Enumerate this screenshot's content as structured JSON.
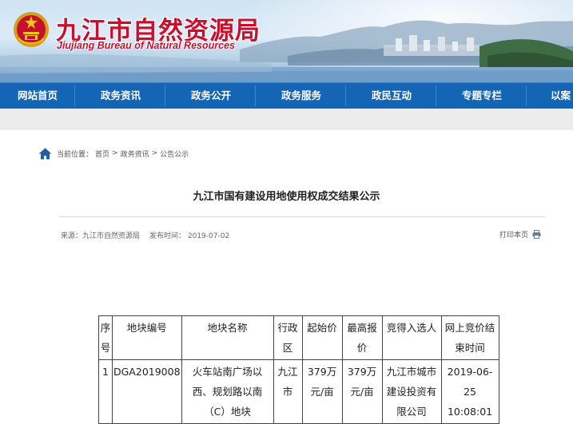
{
  "header": {
    "title_cn": "九江市自然资源局",
    "title_en": "Jiujiang Bureau of Natural Resources"
  },
  "nav": {
    "items": [
      {
        "label": "网站首页"
      },
      {
        "label": "政务资讯"
      },
      {
        "label": "政务公开"
      },
      {
        "label": "政务服务"
      },
      {
        "label": "政民互动"
      },
      {
        "label": "专题专栏"
      },
      {
        "label": "以案"
      }
    ]
  },
  "breadcrumb": {
    "prefix": "当前位置：",
    "items": [
      "首页",
      "政务资讯",
      "公告公示"
    ],
    "separator": ">"
  },
  "article": {
    "title": "九江市国有建设用地使用权成交结果公示",
    "source": "来源：九江市自然资源局",
    "date": "发布时间： 2019-07-02",
    "print_label": "打印本页"
  },
  "table": {
    "headers": [
      {
        "text": "序号"
      },
      {
        "text": "地块编号"
      },
      {
        "text": "地块名称"
      },
      {
        "text": "行政区"
      },
      {
        "text": "起始价"
      },
      {
        "text": "最高报价"
      },
      {
        "text": "竞得入选人"
      },
      {
        "text": "网上竞价结束时间"
      }
    ],
    "rows": [
      {
        "cells": [
          {
            "text": "1"
          },
          {
            "text": "DGA2019008"
          },
          {
            "text": "火车站南广场以西、规划路以南（C）地块"
          },
          {
            "text": "九江市"
          },
          {
            "text": "379万元/亩"
          },
          {
            "text": "379万元/亩"
          },
          {
            "text": "九江市城市建设投资有限公司"
          },
          {
            "text": "2019-06-25 10:08:01"
          }
        ]
      }
    ]
  },
  "colors": {
    "nav_bg": "#1565b7",
    "title_red": "#c8102e"
  },
  "icons": {
    "home": "home-icon",
    "print": "printer-icon",
    "emblem": "national-emblem-icon"
  }
}
